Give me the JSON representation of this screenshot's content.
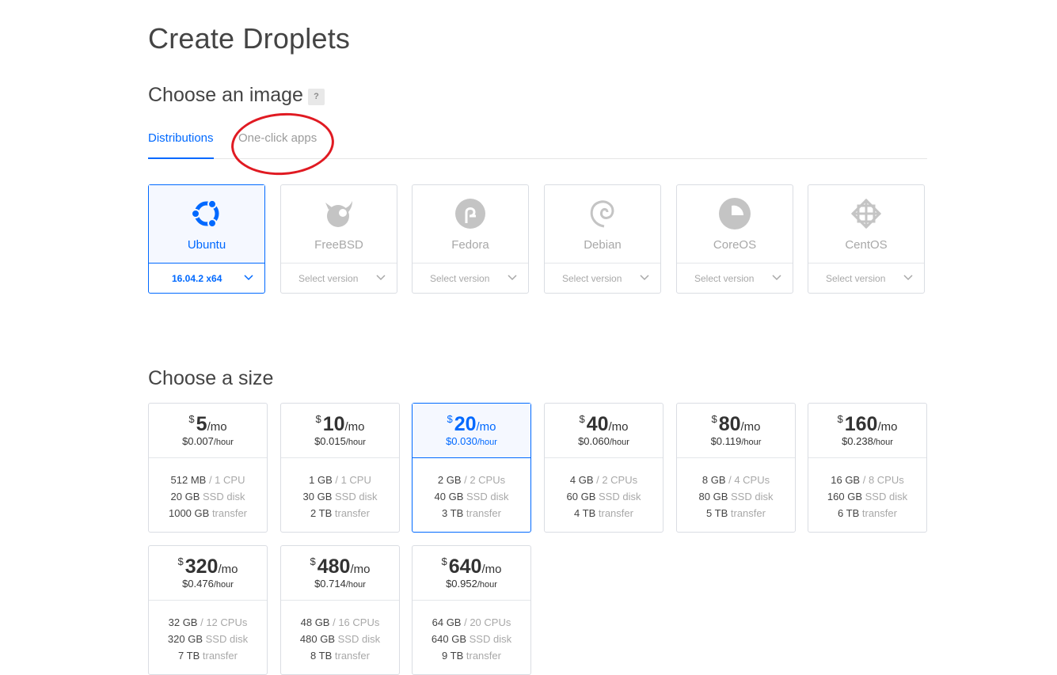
{
  "page": {
    "title": "Create Droplets"
  },
  "image_section": {
    "title": "Choose an image",
    "help": "?",
    "tabs": [
      {
        "label": "Distributions",
        "active": true
      },
      {
        "label": "One-click apps",
        "active": false
      }
    ],
    "distributions": [
      {
        "name": "Ubuntu",
        "version": "16.04.2 x64",
        "icon": "ubuntu-icon",
        "selected": true
      },
      {
        "name": "FreeBSD",
        "version": "Select version",
        "icon": "freebsd-icon",
        "selected": false
      },
      {
        "name": "Fedora",
        "version": "Select version",
        "icon": "fedora-icon",
        "selected": false
      },
      {
        "name": "Debian",
        "version": "Select version",
        "icon": "debian-icon",
        "selected": false
      },
      {
        "name": "CoreOS",
        "version": "Select version",
        "icon": "coreos-icon",
        "selected": false
      },
      {
        "name": "CentOS",
        "version": "Select version",
        "icon": "centos-icon",
        "selected": false
      }
    ]
  },
  "size_section": {
    "title": "Choose a size",
    "currency": "$",
    "per_month": "/mo",
    "per_hour": "/hour",
    "plans": [
      {
        "monthly": "5",
        "hourly": "$0.007",
        "memory": "512 MB",
        "cpu": "1 CPU",
        "disk": "20 GB",
        "transfer": "1000 GB",
        "selected": false
      },
      {
        "monthly": "10",
        "hourly": "$0.015",
        "memory": "1 GB",
        "cpu": "1 CPU",
        "disk": "30 GB",
        "transfer": "2 TB",
        "selected": false
      },
      {
        "monthly": "20",
        "hourly": "$0.030",
        "memory": "2 GB",
        "cpu": "2 CPUs",
        "disk": "40 GB",
        "transfer": "3 TB",
        "selected": true
      },
      {
        "monthly": "40",
        "hourly": "$0.060",
        "memory": "4 GB",
        "cpu": "2 CPUs",
        "disk": "60 GB",
        "transfer": "4 TB",
        "selected": false
      },
      {
        "monthly": "80",
        "hourly": "$0.119",
        "memory": "8 GB",
        "cpu": "4 CPUs",
        "disk": "80 GB",
        "transfer": "5 TB",
        "selected": false
      },
      {
        "monthly": "160",
        "hourly": "$0.238",
        "memory": "16 GB",
        "cpu": "8 CPUs",
        "disk": "160 GB",
        "transfer": "6 TB",
        "selected": false
      },
      {
        "monthly": "320",
        "hourly": "$0.476",
        "memory": "32 GB",
        "cpu": "12 CPUs",
        "disk": "320 GB",
        "transfer": "7 TB",
        "selected": false
      },
      {
        "monthly": "480",
        "hourly": "$0.714",
        "memory": "48 GB",
        "cpu": "16 CPUs",
        "disk": "480 GB",
        "transfer": "8 TB",
        "selected": false
      },
      {
        "monthly": "640",
        "hourly": "$0.952",
        "memory": "64 GB",
        "cpu": "20 CPUs",
        "disk": "640 GB",
        "transfer": "9 TB",
        "selected": false
      }
    ],
    "labels": {
      "disk": "SSD disk",
      "transfer": "transfer"
    }
  },
  "colors": {
    "accent": "#0069ff",
    "annotation": "#e01a22",
    "muted": "#a8a8a8"
  }
}
